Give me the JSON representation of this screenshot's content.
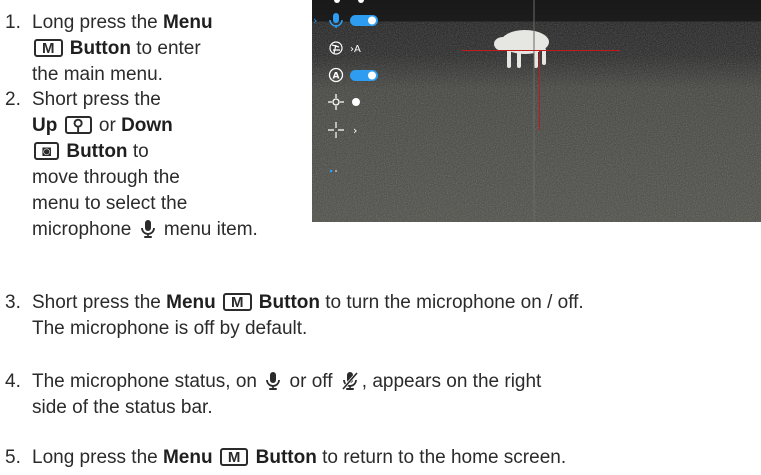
{
  "steps": [
    {
      "number": "1.",
      "lines": [
        [
          "Long press the ",
          {
            "b": "Menu"
          }
        ],
        [
          {
            "key": "M"
          },
          " ",
          {
            "b": "Button"
          },
          " to enter"
        ],
        [
          "the main menu."
        ]
      ]
    },
    {
      "number": "2.",
      "lines": [
        [
          "Short press the"
        ],
        [
          {
            "b": "Up"
          },
          " ",
          {
            "key": "⚲"
          },
          " or ",
          {
            "b": "Down"
          }
        ],
        [
          {
            "key": "◙"
          },
          " ",
          {
            "b": "Button"
          },
          " to"
        ],
        [
          "move through the"
        ],
        [
          "menu to select the"
        ],
        [
          "microphone ",
          {
            "icon": "mic-on"
          },
          " menu item."
        ]
      ]
    },
    {
      "number": "3.",
      "lines": [
        [
          "Short press the ",
          {
            "b": "Menu"
          },
          " ",
          {
            "key": "M"
          },
          " ",
          {
            "b": "Button"
          },
          " to turn the microphone on / off."
        ],
        [
          "The microphone is off by default."
        ]
      ]
    },
    {
      "number": "4.",
      "lines": [
        [
          "The microphone status, on ",
          {
            "icon": "mic-on"
          },
          " or off ",
          {
            "icon": "mic-off"
          },
          ", appears on the right"
        ],
        [
          "side of the status bar."
        ]
      ]
    },
    {
      "number": "5.",
      "lines": [
        [
          "Long press the ",
          {
            "b": "Menu"
          },
          " ",
          {
            "key": "M"
          },
          " ",
          {
            "b": "Button"
          },
          " to return to the home screen."
        ]
      ]
    }
  ],
  "screen": {
    "menu_items": [
      {
        "icon": "microphone-icon",
        "value": "toggle-on",
        "selected": true
      },
      {
        "icon": "aperture-icon",
        "value": "›A"
      },
      {
        "icon": "auto-icon",
        "value": "toggle-on"
      },
      {
        "icon": "move-icon",
        "value": "dot"
      },
      {
        "icon": "crosshair-icon",
        "value": "›"
      }
    ],
    "colors": {
      "accent": "#2e9cf0",
      "reticle": "#c21a1a"
    }
  }
}
